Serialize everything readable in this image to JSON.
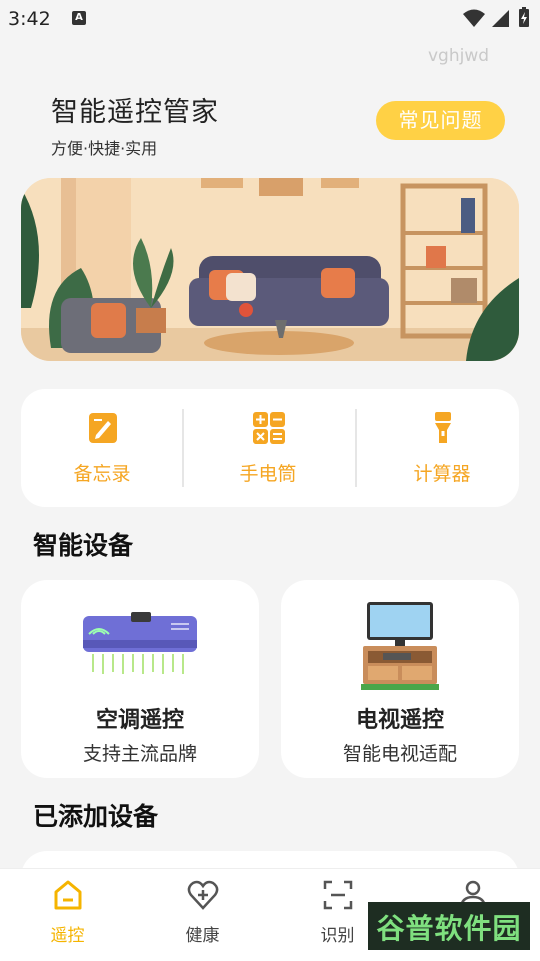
{
  "status_bar": {
    "time": "3:42",
    "notif_letter": "A"
  },
  "header": {
    "watermark": "vghjwd",
    "title": "智能遥控管家",
    "subtitle": "方便·快捷·实用",
    "faq_button": "常见问题"
  },
  "quick_tools": [
    {
      "label": "备忘录",
      "icon": "memo-icon"
    },
    {
      "label": "手电筒",
      "icon": "calculator-grid-icon"
    },
    {
      "label": "计算器",
      "icon": "flashlight-icon"
    }
  ],
  "smart_devices": {
    "title": "智能设备",
    "items": [
      {
        "name": "空调遥控",
        "desc": "支持主流品牌",
        "icon": "air-conditioner-icon"
      },
      {
        "name": "电视遥控",
        "desc": "智能电视适配",
        "icon": "tv-icon"
      }
    ]
  },
  "added_devices": {
    "title": "已添加设备"
  },
  "tabs": [
    {
      "label": "遥控",
      "icon": "home-icon",
      "active": true
    },
    {
      "label": "健康",
      "icon": "heart-plus-icon",
      "active": false
    },
    {
      "label": "识别",
      "icon": "scan-icon",
      "active": false
    },
    {
      "label": "",
      "icon": "user-icon",
      "active": false
    }
  ],
  "overlay_badge": "谷普软件园",
  "colors": {
    "accent": "#f5a623",
    "button": "#ffd145",
    "background": "#f4f4f4"
  }
}
